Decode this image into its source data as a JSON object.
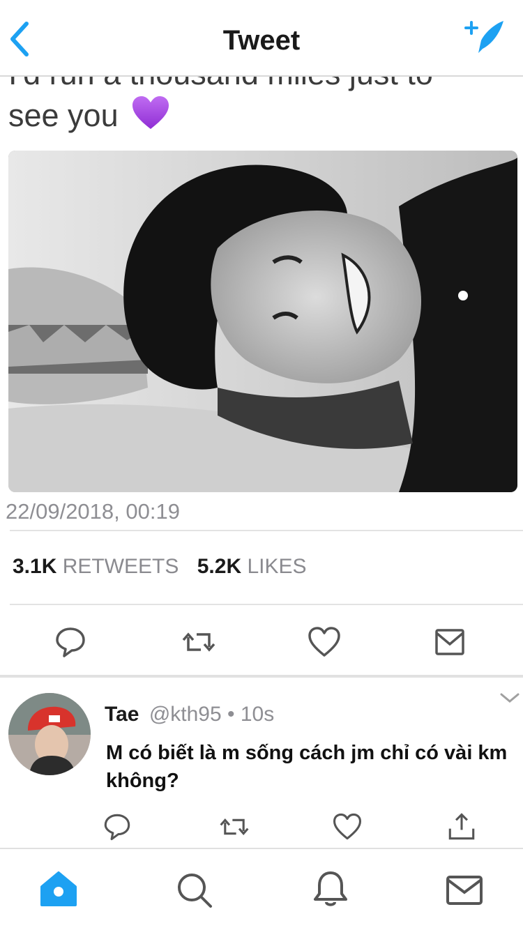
{
  "header": {
    "title": "Tweet"
  },
  "tweet": {
    "text_cut_line": "I'd run a thousand miles just to",
    "text_visible": "see you",
    "emoji": "purple-heart",
    "timestamp": "22/09/2018, 00:19",
    "retweets_count": "3.1K",
    "retweets_label": "RETWEETS",
    "likes_count": "5.2K",
    "likes_label": "LIKES"
  },
  "reply": {
    "name": "Tae",
    "meta": "@kth95 • 10s",
    "text": "M có biết là m sống cách jm chỉ có vài km không?"
  },
  "icons": {
    "back": "chevron-left-icon",
    "compose": "compose-feather-icon",
    "reply": "speech-bubble-icon",
    "retweet": "retweet-icon",
    "like": "heart-icon",
    "dm": "envelope-icon",
    "share": "share-icon",
    "tabs": [
      "home-icon",
      "search-icon",
      "bell-icon",
      "envelope-icon"
    ]
  },
  "colors": {
    "accent": "#1da1f2",
    "icon_gray": "#555555",
    "meta_gray": "#8e8e93",
    "emoji_purple": "#a13ee0"
  }
}
